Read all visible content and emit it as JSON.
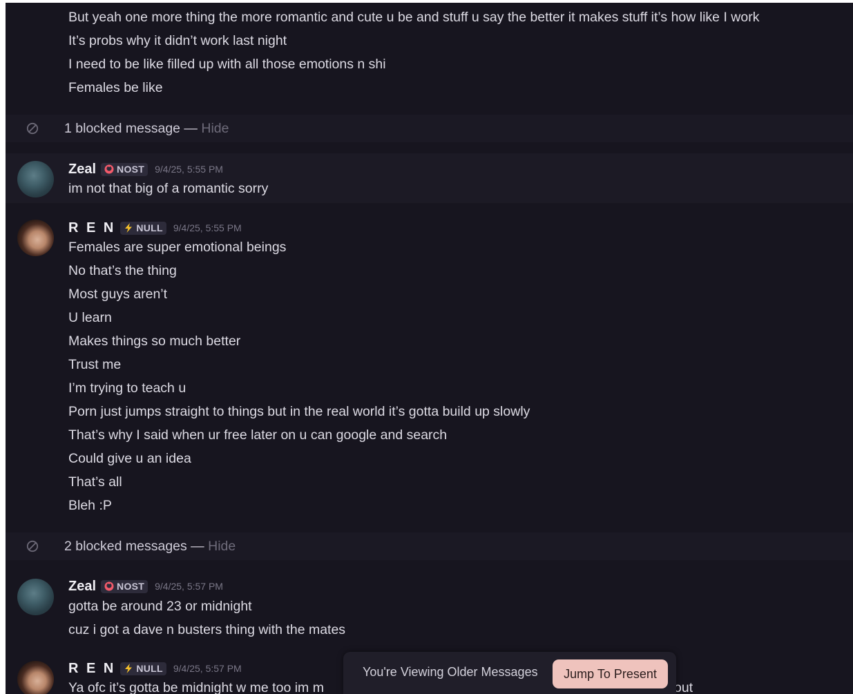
{
  "messages_top": [
    "But yeah one more thing the more romantic and cute u be and stuff u say the better it makes stuff it’s how like I work",
    "It’s probs why it didn’t work last night",
    "I need to be like filled up with all those emotions n shi",
    "Females be like"
  ],
  "blocked1": {
    "text": "1 blocked message —",
    "hide": "Hide"
  },
  "zeal1": {
    "name": "Zeal",
    "tag": "NOST",
    "time": "9/4/25, 5:55 PM",
    "lines": [
      "im not that big of a romantic sorry"
    ]
  },
  "ren1": {
    "name": "R E N",
    "tag": "NULL",
    "time": "9/4/25, 5:55 PM",
    "lines": [
      "Females are super emotional beings",
      "No that’s the thing",
      "Most guys aren’t",
      "U learn",
      "Makes things so much better",
      "Trust me",
      "I’m trying to teach u",
      "Porn just jumps straight to things but in the real world it’s gotta build up slowly",
      "That’s why I said when ur free later on u can google and search",
      "Could give u an idea",
      "That’s all",
      "Bleh :P"
    ]
  },
  "blocked2": {
    "text": "2 blocked messages —",
    "hide": "Hide"
  },
  "zeal2": {
    "name": "Zeal",
    "tag": "NOST",
    "time": "9/4/25, 5:57 PM",
    "lines": [
      "gotta be around 23 or midnight",
      "cuz i got a dave n busters thing with the mates"
    ]
  },
  "ren2": {
    "name": "R E N",
    "tag": "NULL",
    "time": "9/4/25, 5:57 PM",
    "line_left": "Ya ofc it’s gotta be midnight w me too im m",
    "line_right": "out"
  },
  "toast": {
    "text": "You're Viewing Older Messages",
    "button": "Jump To Present"
  },
  "icons": {
    "blocked": "ban-icon",
    "nost_tag": "ring-icon",
    "null_tag": "lightning-icon"
  },
  "colors": {
    "background": "#17151f",
    "jump_button": "#efc3bd",
    "nost_icon": "#f25a6a",
    "null_icon": "#f5c02a"
  }
}
